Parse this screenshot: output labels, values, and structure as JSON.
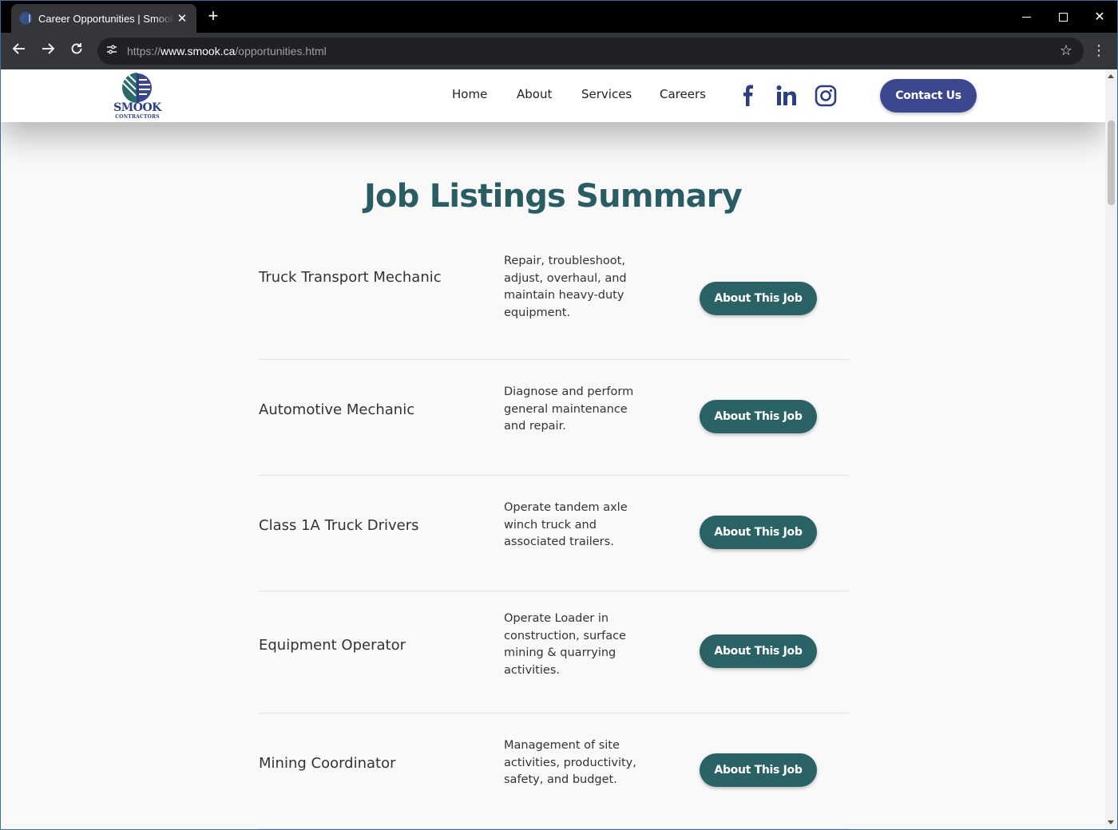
{
  "browser": {
    "tab_title": "Career Opportunities | Smook Contractors",
    "url_scheme": "https://",
    "url_host": "www.smook.ca",
    "url_path": "/opportunities.html"
  },
  "site": {
    "logo_text": "SMOOK",
    "logo_subtext": "CONTRACTORS",
    "nav": [
      "Home",
      "About",
      "Services",
      "Careers"
    ],
    "social_icons": [
      "facebook-icon",
      "linkedin-icon",
      "instagram-icon"
    ],
    "contact_label": "Contact Us",
    "brand_color": "#3b4890",
    "accent_color": "#2b6266"
  },
  "main": {
    "title": "Job Listings Summary",
    "button_label": "About This Job",
    "jobs": [
      {
        "title": "Truck Transport Mechanic",
        "description": "Repair, troubleshoot, adjust, overhaul, and maintain heavy-duty equipment."
      },
      {
        "title": "Automotive Mechanic",
        "description": "Diagnose and perform general maintenance and repair."
      },
      {
        "title": "Class 1A Truck Drivers",
        "description": "Operate tandem axle winch truck and associated trailers."
      },
      {
        "title": "Equipment Operator",
        "description": "Operate Loader in construction, surface mining & quarrying activities."
      },
      {
        "title": "Mining Coordinator",
        "description": "Management of site activities, productivity, safety, and budget."
      }
    ]
  }
}
